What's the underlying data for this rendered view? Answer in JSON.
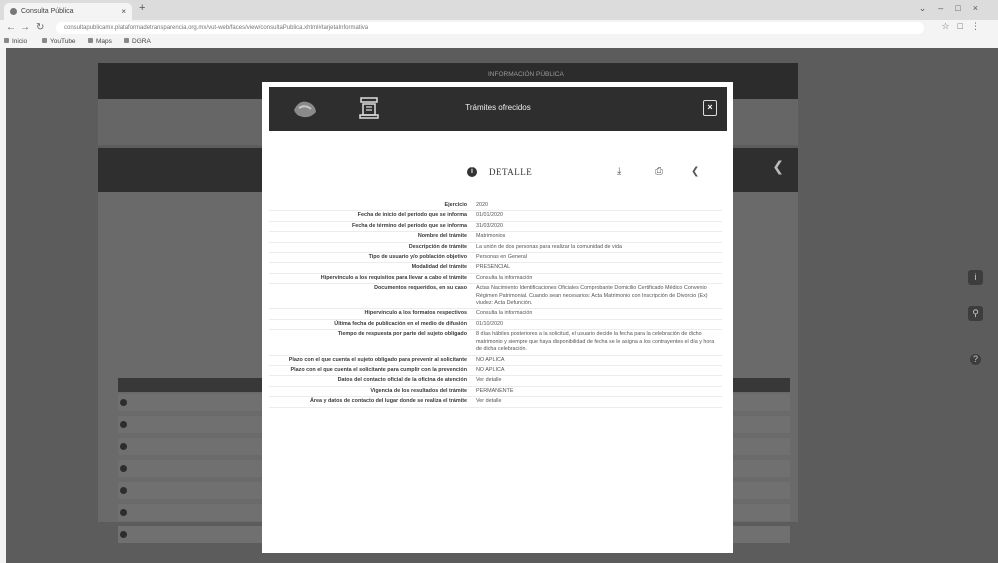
{
  "browser": {
    "tab_title": "Consulta Pública",
    "tab_close": "×",
    "new_tab": "+",
    "url": "consultapublicamx.plataformadetransparencia.org.mx/vut-web/faces/view/consultaPublica.xhtml#tarjetaInformativa",
    "bookmarks": [
      "Inicio",
      "YouTube",
      "Maps",
      "DGRA"
    ]
  },
  "background_page": {
    "top_banner": "INFORMACIÓN PÚBLICA"
  },
  "modal": {
    "title": "Trámites ofrecidos",
    "close_label": "×",
    "detail_label": "DETALLE",
    "rows": [
      {
        "key": "Ejercicio",
        "value": "2020"
      },
      {
        "key": "Fecha de inicio del periodo que se informa",
        "value": "01/01/2020"
      },
      {
        "key": "Fecha de término del periodo que se informa",
        "value": "31/03/2020"
      },
      {
        "key": "Nombre del trámite",
        "value": "Matrimonios"
      },
      {
        "key": "Descripción de trámite",
        "value": "La unión de dos personas para realizar la comunidad de vida"
      },
      {
        "key": "Tipo de usuario y/o población objetivo",
        "value": "Personas en General"
      },
      {
        "key": "Modalidad del trámite",
        "value": "PRESENCIAL"
      },
      {
        "key": "Hipervínculo a los requisitos para llevar a cabo el trámite",
        "value": "Consulta la información"
      },
      {
        "key": "Documentos requeridos, en su caso",
        "value": "Actas Nacimiento Identificaciones Oficiales Comprobante Domicilio Certificado Médico Convenio Régimen Patrimonial. Cuando sean necesarios: Acta Matrimonio con Inscripción de Divorcio (Ex) viudez: Acta Defunción."
      },
      {
        "key": "Hipervínculo a los formatos respectivos",
        "value": "Consulta la información"
      },
      {
        "key": "Última fecha de publicación en el medio de difusión",
        "value": "01/10/2020"
      },
      {
        "key": "Tiempo de respuesta por parte del sujeto obligado",
        "value": "8 días hábiles posteriores a la solicitud, el usuario decide la fecha para la celebración de dicho matrimonio y siempre que haya disponibilidad de fecha se le asigna a los contrayentes el día y hora de dicha celebración."
      },
      {
        "key": "Plazo con el que cuenta el sujeto obligado para prevenir al solicitante",
        "value": "NO APLICA"
      },
      {
        "key": "Plazo con el que cuenta el solicitante para cumplir con la prevención",
        "value": "NO APLICA"
      },
      {
        "key": "Datos del contacto oficial de la oficina de atención",
        "value": "Ver detalle"
      },
      {
        "key": "Vigencia de los resultados del trámite",
        "value": "PERMANENTE"
      },
      {
        "key": "Área y datos de contacto del lugar donde se realiza el trámite",
        "value": "Ver detalle"
      }
    ]
  },
  "icons": {
    "info": "info-icon",
    "download": "download-icon",
    "print": "print-icon",
    "share": "share-icon",
    "close": "close-icon"
  },
  "colors": {
    "header_dark": "#2e2e2e",
    "overlay": "#5c5c5c",
    "modal_bg": "#ffffff"
  }
}
